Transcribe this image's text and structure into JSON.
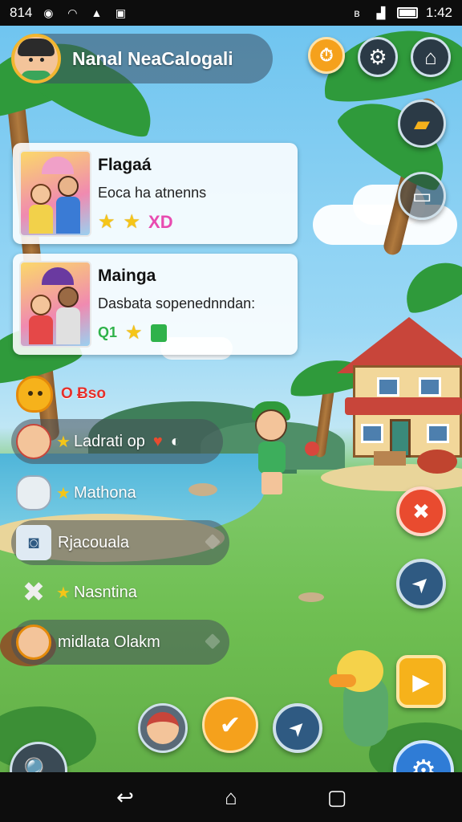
{
  "statusbar": {
    "carrier": "814",
    "time": "1:42",
    "left_icons": [
      "notification-icon",
      "wifi-icon",
      "alert-icon",
      "photo-icon"
    ],
    "right_icons": [
      "bluetooth-icon",
      "signal-icon",
      "battery-icon"
    ]
  },
  "profile": {
    "name": "Nanal NeaCalogali"
  },
  "top_buttons": {
    "alert_glyph": "⏱",
    "settings_glyph": "⚙",
    "home_glyph": "⌂",
    "folder_glyph": "▰",
    "window_glyph": "▭"
  },
  "quests": [
    {
      "title": "Flagaá",
      "desc": "Eoca ha atnenns",
      "extra": "XD",
      "extra_color": "#e84bb0"
    },
    {
      "title": "Mainga",
      "desc": "Dasbata sopenednndan:",
      "extra_left": "Q1",
      "extra": "",
      "extra_color": "#2fb24a"
    }
  ],
  "menu": {
    "header": "O Ƀso",
    "items": [
      {
        "label": "Ladrati op",
        "star": "★"
      },
      {
        "label": "Mathona",
        "star": "★"
      },
      {
        "label": "Rjacouala",
        "star": ""
      },
      {
        "label": "Nasntina",
        "star": "★"
      },
      {
        "label": "midlata Olakm",
        "star": ""
      }
    ]
  },
  "right_actions": {
    "tools_glyph": "✖",
    "compass_glyph": "➤",
    "play_glyph": "▶"
  },
  "bottom_actions": {
    "confirm_glyph": "✔",
    "nav_glyph": "➤",
    "search_glyph": "🔍",
    "settings_glyph": "⚙"
  },
  "navbar": {
    "back_glyph": "↩",
    "home_glyph": "⌂",
    "recents_glyph": "▢"
  },
  "colors": {
    "accent_orange": "#f5a11c",
    "accent_red": "#e94b2f",
    "accent_blue": "#2f7cd6",
    "star": "#f5c518"
  }
}
